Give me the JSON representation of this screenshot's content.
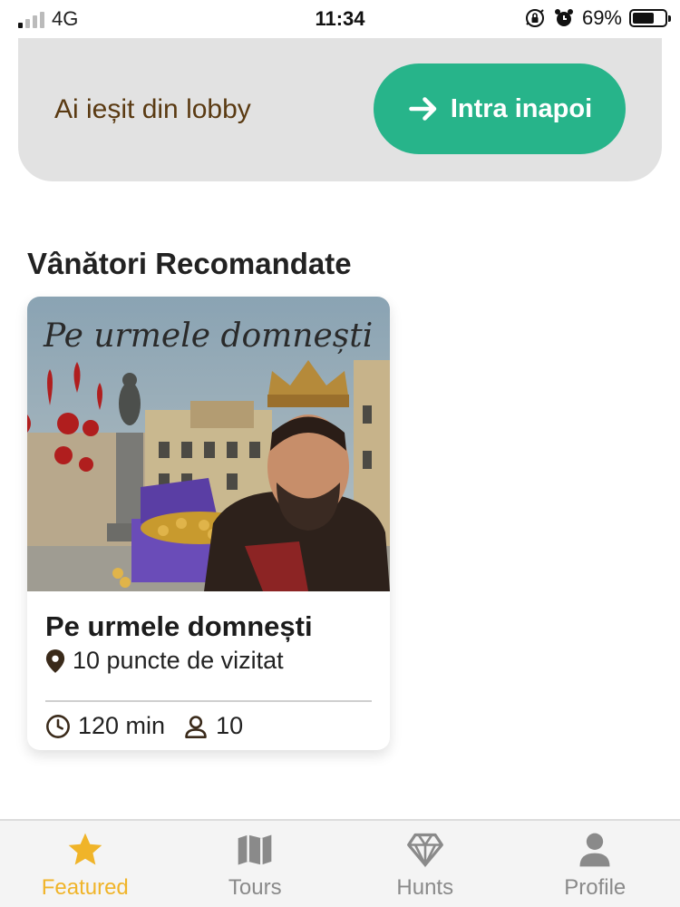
{
  "status_bar": {
    "network": "4G",
    "time": "11:34",
    "battery_percent": "69%",
    "icons": [
      "signal-icon",
      "orientation-lock-icon",
      "alarm-icon",
      "battery-icon"
    ]
  },
  "lobby_banner": {
    "message": "Ai ieșit din lobby",
    "rejoin_label": "Intra inapoi",
    "rejoin_icon": "arrow-right-icon",
    "accent_color": "#27b48a"
  },
  "featured": {
    "section_title": "Vânători Recomandate",
    "cards": [
      {
        "title": "Pe urmele domnești",
        "image_caption": "Pe urmele domnești",
        "points": "10 puncte de vizitat",
        "duration": "120 min",
        "players": "10"
      }
    ]
  },
  "tab_bar": {
    "active_color": "#f0b429",
    "inactive_color": "#8a8a8a",
    "tabs": [
      {
        "label": "Featured",
        "icon": "star-icon",
        "active": true
      },
      {
        "label": "Tours",
        "icon": "map-icon",
        "active": false
      },
      {
        "label": "Hunts",
        "icon": "diamond-icon",
        "active": false
      },
      {
        "label": "Profile",
        "icon": "person-icon",
        "active": false
      }
    ]
  }
}
